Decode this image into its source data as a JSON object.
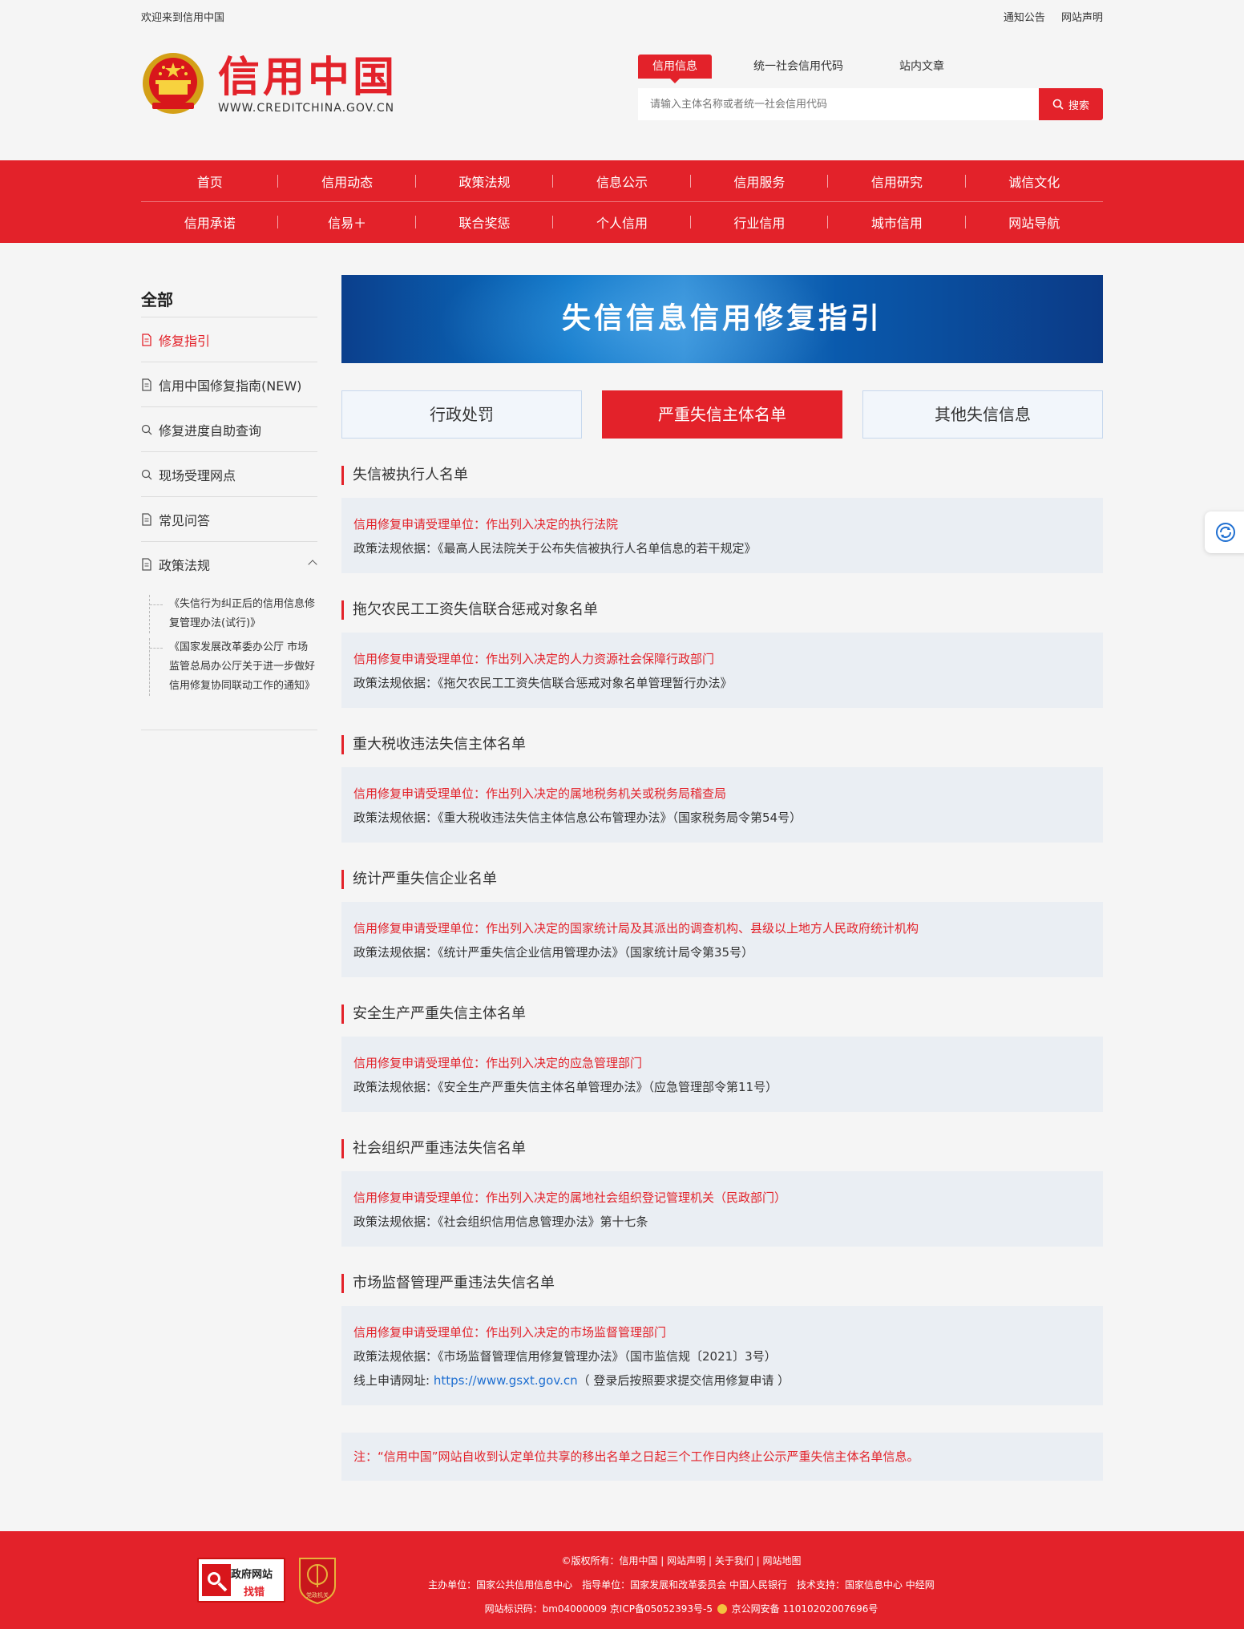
{
  "topbar": {
    "welcome": "欢迎来到信用中国",
    "links": [
      "通知公告",
      "网站声明"
    ]
  },
  "logo": {
    "name": "信用中国",
    "domain": "WWW.CREDITCHINA.GOV.CN"
  },
  "search": {
    "tabs": [
      "信用信息",
      "统一社会信用代码",
      "站内文章"
    ],
    "active_tab": 0,
    "placeholder": "请输入主体名称或者统一社会信用代码",
    "button": "搜索"
  },
  "nav": {
    "row1": [
      "首页",
      "信用动态",
      "政策法规",
      "信息公示",
      "信用服务",
      "信用研究",
      "诚信文化"
    ],
    "row2": [
      "信用承诺",
      "信易＋",
      "联合奖惩",
      "个人信用",
      "行业信用",
      "城市信用",
      "网站导航"
    ]
  },
  "sidebar": {
    "title": "全部",
    "items": [
      {
        "label": "修复指引",
        "icon": "document-icon",
        "active": true
      },
      {
        "label": "信用中国修复指南(NEW)",
        "icon": "document-icon"
      },
      {
        "label": "修复进度自助查询",
        "icon": "search-icon"
      },
      {
        "label": "现场受理网点",
        "icon": "search-icon"
      },
      {
        "label": "常见问答",
        "icon": "document-icon"
      },
      {
        "label": "政策法规",
        "icon": "document-icon",
        "expanded": true
      }
    ],
    "sub_items": [
      "《失信行为纠正后的信用信息修复管理办法(试行)》",
      "《国家发展改革委办公厅 市场监管总局办公厅关于进一步做好信用修复协同联动工作的通知》"
    ]
  },
  "banner": {
    "title": "失信信息信用修复指引"
  },
  "main_tabs": [
    "行政处罚",
    "严重失信主体名单",
    "其他失信信息"
  ],
  "main_active_tab": 1,
  "sections": [
    {
      "title": "失信被执行人名单",
      "unit": "信用修复申请受理单位：作出列入决定的执行法院",
      "basis": "政策法规依据：《最高人民法院关于公布失信被执行人名单信息的若干规定》"
    },
    {
      "title": "拖欠农民工工资失信联合惩戒对象名单",
      "unit": "信用修复申请受理单位：作出列入决定的人力资源社会保障行政部门",
      "basis": "政策法规依据：《拖欠农民工工资失信联合惩戒对象名单管理暂行办法》"
    },
    {
      "title": "重大税收违法失信主体名单",
      "unit": "信用修复申请受理单位：作出列入决定的属地税务机关或税务局稽查局",
      "basis": "政策法规依据：《重大税收违法失信主体信息公布管理办法》（国家税务局令第54号）"
    },
    {
      "title": "统计严重失信企业名单",
      "unit": "信用修复申请受理单位：作出列入决定的国家统计局及其派出的调查机构、县级以上地方人民政府统计机构",
      "basis": "政策法规依据：《统计严重失信企业信用管理办法》（国家统计局令第35号）"
    },
    {
      "title": "安全生产严重失信主体名单",
      "unit": "信用修复申请受理单位：作出列入决定的应急管理部门",
      "basis": "政策法规依据：《安全生产严重失信主体名单管理办法》（应急管理部令第11号）"
    },
    {
      "title": "社会组织严重违法失信名单",
      "unit": "信用修复申请受理单位：作出列入决定的属地社会组织登记管理机关（民政部门）",
      "basis": "政策法规依据：《社会组织信用信息管理办法》第十七条"
    },
    {
      "title": "市场监督管理严重违法失信名单",
      "unit": "信用修复申请受理单位：作出列入决定的市场监督管理部门",
      "basis": "政策法规依据：《市场监督管理信用修复管理办法》（国市监信规〔2021〕3号）",
      "online_label": "线上申请网址: ",
      "online_url": "https://www.gsxt.gov.cn",
      "online_tip": "（ 登录后按照要求提交信用修复申请 ）"
    }
  ],
  "note": "注：“信用中国”网站自收到认定单位共享的移出名单之日起三个工作日内终止公示严重失信主体名单信息。",
  "footer": {
    "gov_badge_line1": "政府网站",
    "gov_badge_line2": "找错",
    "party_badge_label": "党政机关",
    "line1": "©版权所有：信用中国 | 网站声明 | 关于我们 | 网站地图",
    "line2": "主办单位：国家公共信用信息中心　指导单位：国家发展和改革委员会 中国人民银行　技术支持：国家信息中心 中经网",
    "line3_a": "网站标识码：bm04000009 京ICP备05052393号-5",
    "line3_b": "京公网安备 11010202007696号"
  },
  "colors": {
    "brand_red": "#e3222a",
    "link_blue": "#1f6fd1",
    "box_bg": "#eaeef3",
    "page_bg": "#f5f5f5"
  }
}
